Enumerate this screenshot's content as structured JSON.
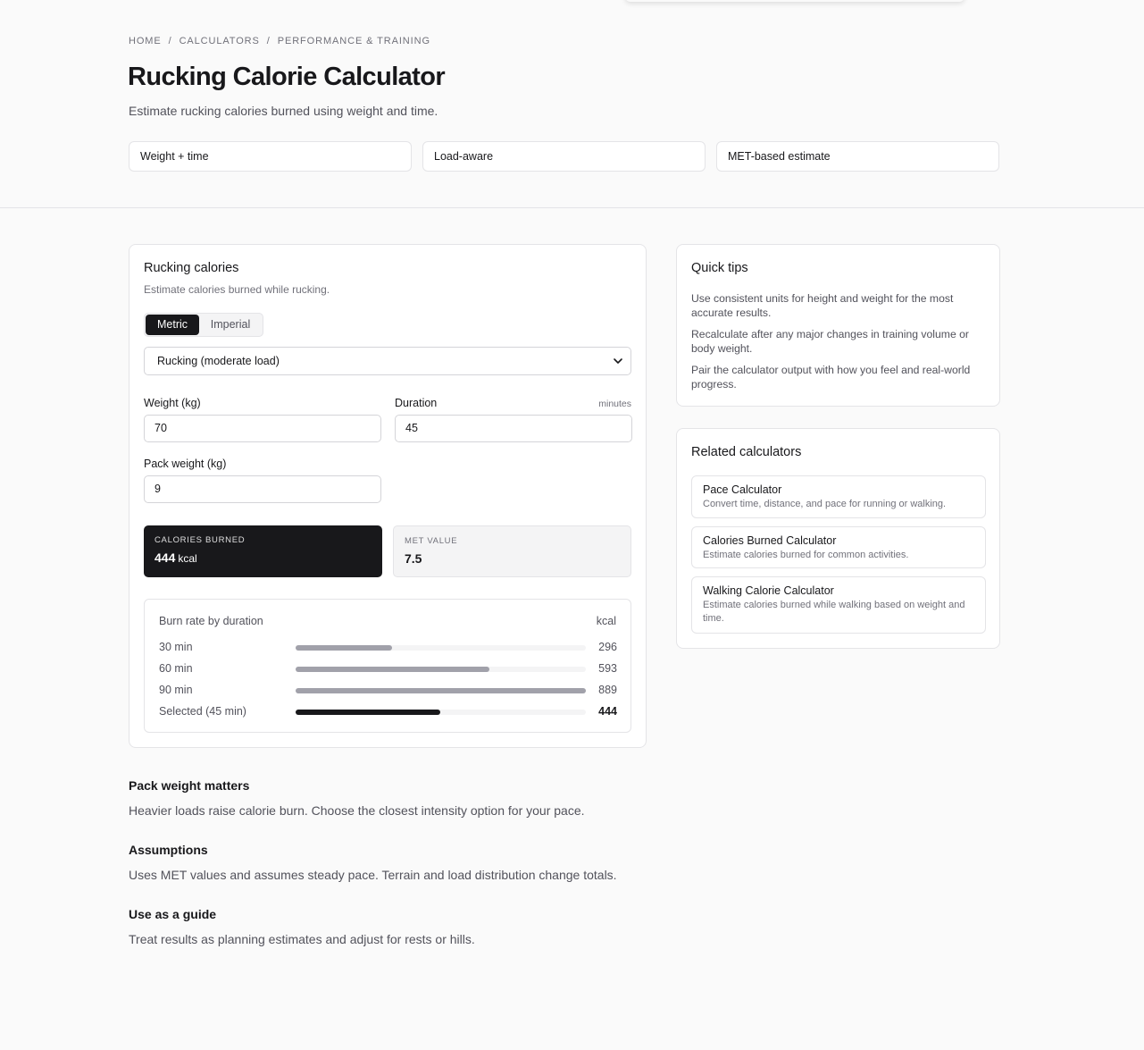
{
  "breadcrumb": [
    "HOME",
    "CALCULATORS",
    "PERFORMANCE & TRAINING"
  ],
  "page": {
    "title": "Rucking Calorie Calculator",
    "subtitle": "Estimate rucking calories burned using weight and time."
  },
  "features": [
    "Weight + time",
    "Load-aware",
    "MET-based estimate"
  ],
  "calculator": {
    "title": "Rucking calories",
    "subtitle": "Estimate calories burned while rucking.",
    "units": {
      "metric": "Metric",
      "imperial": "Imperial",
      "selected": "Metric"
    },
    "activity": {
      "selected": "Rucking (moderate load)",
      "chevron": "⌄"
    },
    "weight": {
      "label": "Weight (kg)",
      "value": "70"
    },
    "duration": {
      "label": "Duration",
      "hint": "minutes",
      "value": "45"
    },
    "pack": {
      "label": "Pack weight (kg)",
      "value": "9"
    },
    "calories": {
      "label": "CALORIES BURNED",
      "value": "444",
      "unit": "kcal"
    },
    "met": {
      "label": "MET VALUE",
      "value": "7.5"
    },
    "burn": {
      "title": "Burn rate by duration",
      "unit": "kcal",
      "max_kcal": 889,
      "rows": [
        {
          "label": "30 min",
          "value": "296",
          "kcal": 296,
          "selected": false
        },
        {
          "label": "60 min",
          "value": "593",
          "kcal": 593,
          "selected": false
        },
        {
          "label": "90 min",
          "value": "889",
          "kcal": 889,
          "selected": false
        },
        {
          "label": "Selected (45 min)",
          "value": "444",
          "kcal": 444,
          "selected": true
        }
      ]
    }
  },
  "tips": {
    "title": "Quick tips",
    "items": [
      "Use consistent units for height and weight for the most accurate results.",
      "Recalculate after any major changes in training volume or body weight.",
      "Pair the calculator output with how you feel and real-world progress."
    ]
  },
  "related": {
    "title": "Related calculators",
    "items": [
      {
        "name": "Pace Calculator",
        "desc": "Convert time, distance, and pace for running or walking."
      },
      {
        "name": "Calories Burned Calculator",
        "desc": "Estimate calories burned for common activities."
      },
      {
        "name": "Walking Calorie Calculator",
        "desc": "Estimate calories burned while walking based on weight and time."
      }
    ]
  },
  "article": [
    {
      "heading": "Pack weight matters",
      "body": "Heavier loads raise calorie burn. Choose the closest intensity option for your pace."
    },
    {
      "heading": "Assumptions",
      "body": "Uses MET values and assumes steady pace. Terrain and load distribution change totals."
    },
    {
      "heading": "Use as a guide",
      "body": "Treat results as planning estimates and adjust for rests or hills."
    }
  ],
  "colors": {
    "accent": "#18181b",
    "bar": "#a1a1aa",
    "track": "#f4f4f5",
    "border": "#e4e4e7"
  }
}
